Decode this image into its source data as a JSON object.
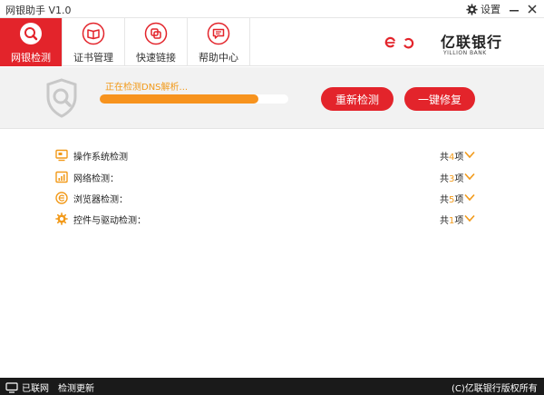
{
  "window": {
    "title": "网银助手 V1.0",
    "settings_label": "设置"
  },
  "nav": {
    "tabs": [
      {
        "label": "网银检测",
        "icon": "search-icon",
        "active": true
      },
      {
        "label": "证书管理",
        "icon": "book-icon",
        "active": false
      },
      {
        "label": "快速链接",
        "icon": "link-icon",
        "active": false
      },
      {
        "label": "帮助中心",
        "icon": "chat-icon",
        "active": false
      }
    ]
  },
  "brand": {
    "name_cn": "亿联银行",
    "name_en": "YILLION BANK",
    "color": "#e3242b"
  },
  "status": {
    "text": "正在检测DNS解析...",
    "progress_percent": 84,
    "recheck_label": "重新检测",
    "fix_label": "一键修复"
  },
  "checks": [
    {
      "label": "操作系统检测",
      "count_prefix": "共",
      "count": "4",
      "count_suffix": "项",
      "icon": "monitor-icon"
    },
    {
      "label": "网络检测：",
      "count_prefix": "共",
      "count": "3",
      "count_suffix": "项",
      "icon": "bar-chart-icon"
    },
    {
      "label": "浏览器检测：",
      "count_prefix": "共",
      "count": "5",
      "count_suffix": "项",
      "icon": "browser-icon"
    },
    {
      "label": "控件与驱动检测：",
      "count_prefix": "共",
      "count": "1",
      "count_suffix": "项",
      "icon": "gear-icon"
    }
  ],
  "footer": {
    "net_status": "已联网",
    "update_label": "检测更新",
    "copyright": "(C)亿联银行版权所有"
  },
  "colors": {
    "accent": "#e3242b",
    "orange": "#f7931e",
    "footer_bg": "#1a1a1a"
  }
}
